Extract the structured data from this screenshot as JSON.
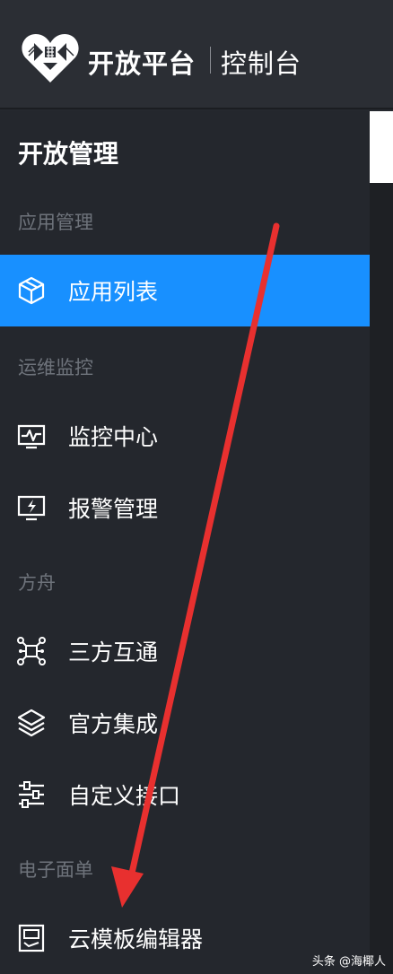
{
  "header": {
    "brand": "开放平台",
    "subtitle": "控制台",
    "logo_icon": "heart-logo-icon"
  },
  "sidebar": {
    "title": "开放管理",
    "groups": [
      {
        "label": "应用管理"
      },
      {
        "label": "运维监控"
      },
      {
        "label": "方舟"
      },
      {
        "label": "电子面单"
      }
    ],
    "items": [
      {
        "label": "应用列表",
        "icon": "cube-icon",
        "active": true
      },
      {
        "label": "监控中心",
        "icon": "monitor-pulse-icon"
      },
      {
        "label": "报警管理",
        "icon": "alert-screen-icon"
      },
      {
        "label": "三方互通",
        "icon": "network-icon"
      },
      {
        "label": "官方集成",
        "icon": "layers-icon"
      },
      {
        "label": "自定义接口",
        "icon": "sliders-icon"
      },
      {
        "label": "云模板编辑器",
        "icon": "template-icon"
      }
    ]
  },
  "annotation": {
    "color": "#e8302f"
  },
  "watermark": "头条 @海椰人",
  "colors": {
    "accent": "#1890ff",
    "sidebar_bg": "#24272d",
    "header_bg": "#2b2e34"
  }
}
